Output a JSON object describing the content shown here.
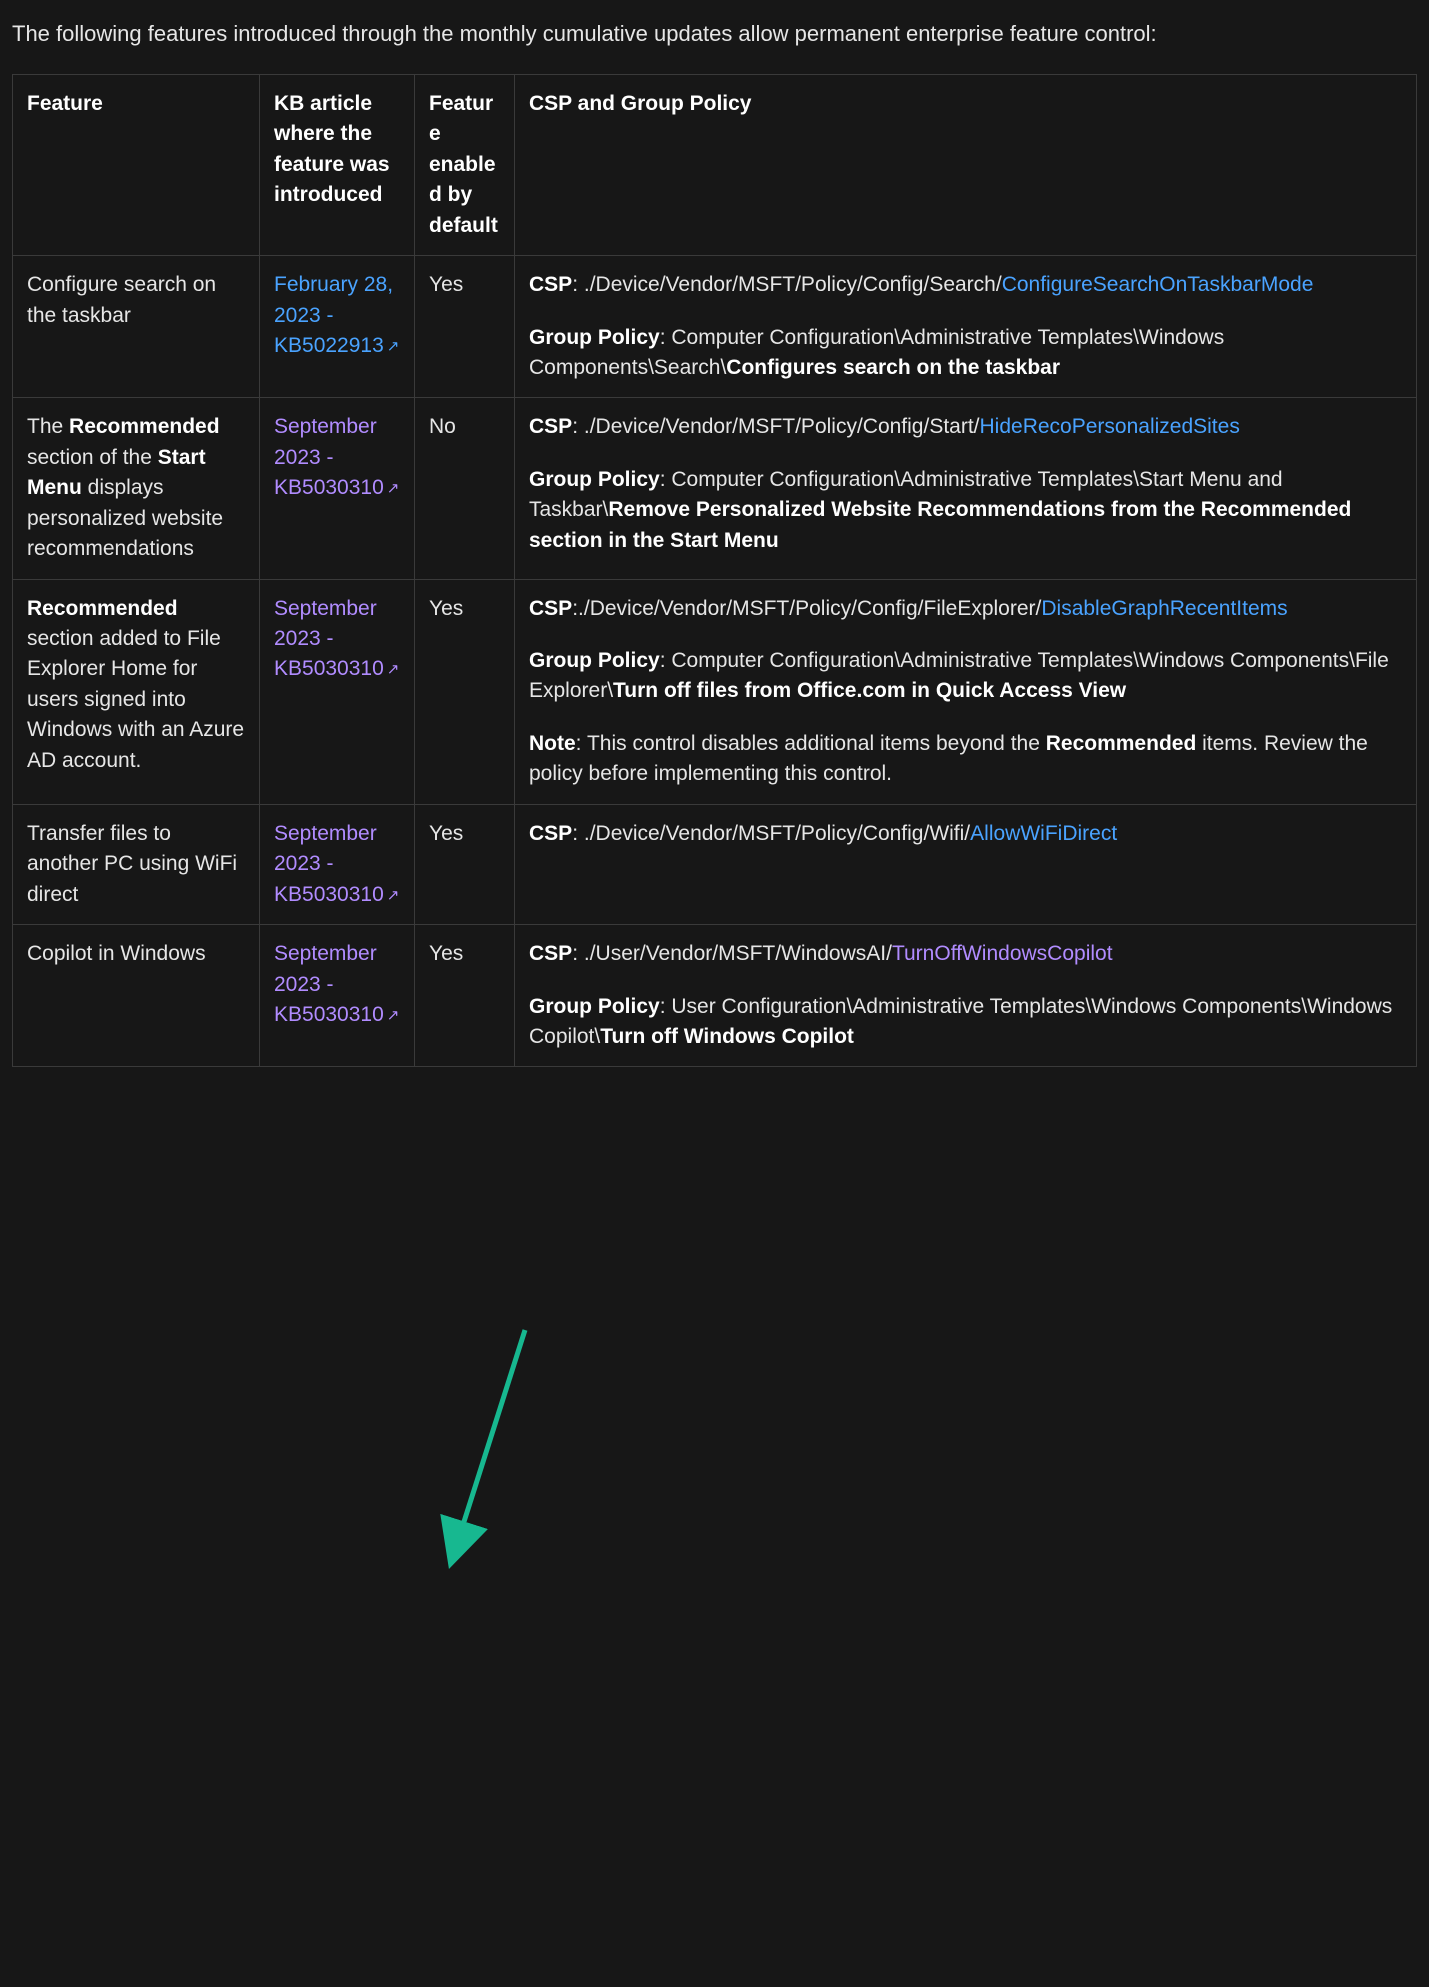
{
  "intro": "The following features introduced through the monthly cumulative updates allow permanent enterprise feature control:",
  "headers": {
    "feature": "Feature",
    "kb": "KB article where the feature was introduced",
    "enabled": "Feature enabled by default",
    "csp": "CSP and Group Policy"
  },
  "labels": {
    "csp": "CSP",
    "gp": "Group Policy",
    "note": "Note"
  },
  "rows": [
    {
      "feature_plain": "Configure search on the taskbar",
      "kb_text": "February 28, 2023 - KB5022913",
      "kb_link_style": "blue",
      "enabled": "Yes",
      "csp_prefix": ": ./Device/Vendor/MSFT/Policy/Config/Search/",
      "csp_link_text": "ConfigureSearchOnTaskbarMode",
      "csp_link_style": "blue",
      "gp_prefix": ": Computer Configuration\\Administrative Templates\\Windows Components\\Search\\",
      "gp_bold_tail": "Configures search on the taskbar"
    },
    {
      "feature_pre": "The ",
      "feature_b1": "Recommended",
      "feature_mid": " section of the ",
      "feature_b2": "Start Menu",
      "feature_post": " displays personalized website recommendations",
      "kb_text": "September 2023 - KB5030310",
      "kb_link_style": "purple",
      "enabled": "No",
      "csp_prefix": ": ./Device/Vendor/MSFT/Policy/Config/Start/",
      "csp_link_text": "HideRecoPersonalizedSites",
      "csp_link_style": "blue",
      "gp_prefix": ": Computer Configuration\\Administrative Templates\\Start Menu and Taskbar\\",
      "gp_bold_tail": "Remove Personalized Website Recommendations from the Recommended section in the Start Menu"
    },
    {
      "feature_b1": "Recommended",
      "feature_post": " section added to File Explorer Home for users signed into Windows with an Azure AD account.",
      "kb_text": "September 2023 - KB5030310",
      "kb_link_style": "purple",
      "enabled": "Yes",
      "csp_prefix": ":./Device/Vendor/MSFT/Policy/Config/FileExplorer/",
      "csp_link_text": "DisableGraphRecentItems",
      "csp_link_style": "blue",
      "gp_prefix": ": Computer Configuration\\Administrative Templates\\Windows Components\\File Explorer\\",
      "gp_bold_tail": "Turn off files from Office.com in Quick Access View",
      "note_pre": ": This control disables additional items beyond the ",
      "note_b": "Recommended",
      "note_post": " items. Review the policy before implementing this control."
    },
    {
      "feature_plain": "Transfer files to another PC using WiFi direct",
      "kb_text": "September 2023 - KB5030310",
      "kb_link_style": "purple",
      "enabled": "Yes",
      "csp_prefix": ": ./Device/Vendor/MSFT/Policy/Config/Wifi/",
      "csp_link_text": "AllowWiFiDirect",
      "csp_link_style": "blue"
    },
    {
      "feature_plain": "Copilot in Windows",
      "kb_text": "September 2023 - KB5030310",
      "kb_link_style": "purple",
      "enabled": "Yes",
      "csp_prefix": ": ./User/Vendor/MSFT/WindowsAI/",
      "csp_link_text": "TurnOffWindowsCopilot",
      "csp_link_style": "purple",
      "gp_prefix": ": User Configuration\\Administrative Templates\\Windows Components\\Windows Copilot\\",
      "gp_bold_tail": "Turn off Windows Copilot"
    }
  ]
}
